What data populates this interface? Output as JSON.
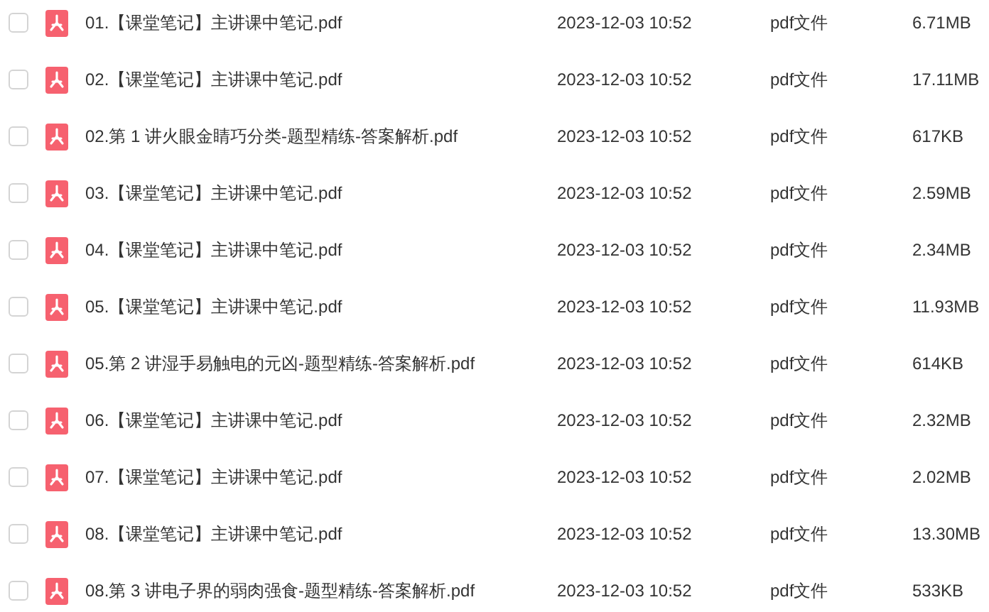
{
  "files": [
    {
      "name": "01.【课堂笔记】主讲课中笔记.pdf",
      "modified": "2023-12-03 10:52",
      "type": "pdf文件",
      "size": "6.71MB",
      "checked": false
    },
    {
      "name": "02.【课堂笔记】主讲课中笔记.pdf",
      "modified": "2023-12-03 10:52",
      "type": "pdf文件",
      "size": "17.11MB",
      "checked": false
    },
    {
      "name": "02.第 1 讲火眼金睛巧分类-题型精练-答案解析.pdf",
      "modified": "2023-12-03 10:52",
      "type": "pdf文件",
      "size": "617KB",
      "checked": false
    },
    {
      "name": "03.【课堂笔记】主讲课中笔记.pdf",
      "modified": "2023-12-03 10:52",
      "type": "pdf文件",
      "size": "2.59MB",
      "checked": false
    },
    {
      "name": "04.【课堂笔记】主讲课中笔记.pdf",
      "modified": "2023-12-03 10:52",
      "type": "pdf文件",
      "size": "2.34MB",
      "checked": false
    },
    {
      "name": "05.【课堂笔记】主讲课中笔记.pdf",
      "modified": "2023-12-03 10:52",
      "type": "pdf文件",
      "size": "11.93MB",
      "checked": false
    },
    {
      "name": "05.第 2 讲湿手易触电的元凶-题型精练-答案解析.pdf",
      "modified": "2023-12-03 10:52",
      "type": "pdf文件",
      "size": "614KB",
      "checked": false
    },
    {
      "name": "06.【课堂笔记】主讲课中笔记.pdf",
      "modified": "2023-12-03 10:52",
      "type": "pdf文件",
      "size": "2.32MB",
      "checked": false
    },
    {
      "name": "07.【课堂笔记】主讲课中笔记.pdf",
      "modified": "2023-12-03 10:52",
      "type": "pdf文件",
      "size": "2.02MB",
      "checked": false
    },
    {
      "name": "08.【课堂笔记】主讲课中笔记.pdf",
      "modified": "2023-12-03 10:52",
      "type": "pdf文件",
      "size": "13.30MB",
      "checked": false
    },
    {
      "name": "08.第 3 讲电子界的弱肉强食-题型精练-答案解析.pdf",
      "modified": "2023-12-03 10:52",
      "type": "pdf文件",
      "size": "533KB",
      "checked": false
    }
  ]
}
